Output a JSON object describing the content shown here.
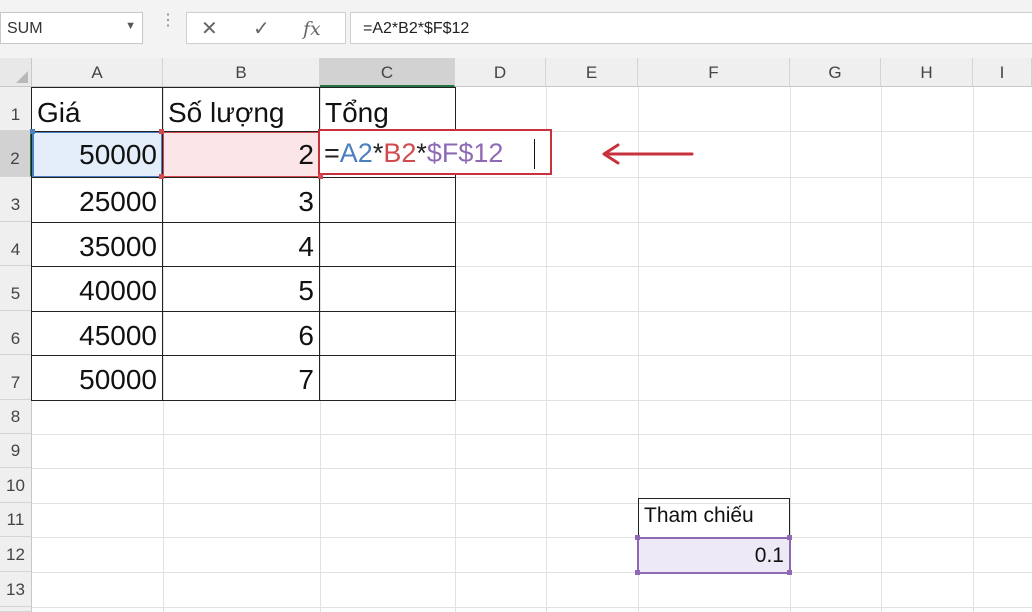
{
  "namebox": {
    "value": "SUM",
    "dropdown_icon": "chevron-down-icon"
  },
  "formula_bar": {
    "cancel_icon": "✕",
    "enter_icon": "✓",
    "fx_icon": "fx",
    "value": "=A2*B2*$F$12"
  },
  "columns": [
    "A",
    "B",
    "C",
    "D",
    "E",
    "F",
    "G",
    "H",
    "I"
  ],
  "rows": [
    "1",
    "2",
    "3",
    "4",
    "5",
    "6",
    "7",
    "8",
    "9",
    "10",
    "11",
    "12",
    "13"
  ],
  "table": {
    "headers": {
      "a": "Giá",
      "b": "Số lượng",
      "c": "Tổng"
    },
    "data": [
      {
        "price": "50000",
        "qty": "2"
      },
      {
        "price": "25000",
        "qty": "3"
      },
      {
        "price": "35000",
        "qty": "4"
      },
      {
        "price": "40000",
        "qty": "5"
      },
      {
        "price": "45000",
        "qty": "6"
      },
      {
        "price": "50000",
        "qty": "7"
      }
    ]
  },
  "editing_cell": {
    "parts": [
      {
        "text": "=",
        "color": "#222222"
      },
      {
        "text": "A2",
        "color": "#4a7fc0"
      },
      {
        "text": "*",
        "color": "#222222"
      },
      {
        "text": "B2",
        "color": "#d04a50"
      },
      {
        "text": "*",
        "color": "#222222"
      },
      {
        "text": "$F$12",
        "color": "#8e6ab5"
      }
    ]
  },
  "reference": {
    "label": "Tham chiếu",
    "value": "0.1"
  },
  "colors": {
    "active_header": "#217346",
    "callout_red": "#c8323c"
  }
}
